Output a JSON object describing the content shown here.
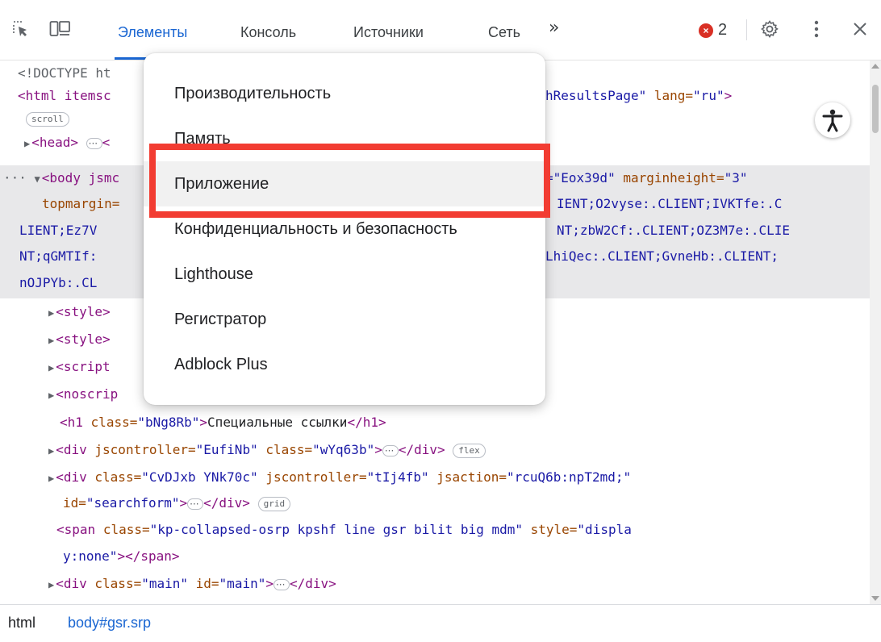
{
  "toolbar": {
    "inspect_icon": "inspect-element-icon",
    "device_icon": "device-toolbar-icon",
    "tabs": [
      "Элементы",
      "Консоль",
      "Источники",
      "Сеть"
    ],
    "more_tabs": "»",
    "error_count": "2",
    "settings_icon": "gear-icon",
    "menu_icon": "kebab-menu-icon",
    "close_icon": "close-icon"
  },
  "menu": {
    "items": [
      "Производительность",
      "Память",
      "Приложение",
      "Конфиденциальность и безопасность",
      "Lighthouse",
      "Регистратор",
      "Adblock Plus"
    ],
    "highlighted": "Приложение"
  },
  "code": {
    "doctype": "<!DOCTYPE ht",
    "html_open": "<html itemsc",
    "html_tail_attr": "hResultsPage\"",
    "html_lang_attr": "lang=",
    "html_lang_val": "\"ru\"",
    "html_close": ">",
    "scroll_badge": "scroll",
    "head_line": "<head>",
    "head_tail": "<",
    "body_ellipsis": "···",
    "body_open": "<body jsmc",
    "body_r1_val": "=\"Eox39d\"",
    "body_r1_attr": "marginheight=",
    "body_r1_val2": "\"3\"",
    "body_l2": "topmargin=",
    "body_r2": "IENT;O2vyse:.CLIENT;IVKTfe:.C",
    "body_l3": "LIENT;Ez7V",
    "body_r3": "NT;zbW2Cf:.CLIENT;OZ3M7e:.CLIE",
    "body_l4": "NT;qGMTIf:",
    "body_r4": "LhiQec:.CLIENT;GvneHb:.CLIENT;",
    "body_l5": "nOJPYb:.CL",
    "style1": "<style>",
    "style2": "<style>",
    "script": "<script",
    "noscript": "<noscrip",
    "h1_open": "<h1",
    "h1_attr": "class=",
    "h1_val": "\"bNg8Rb\"",
    "h1_text": "Специальные ссылки",
    "h1_close": "</h1>",
    "div1_open": "<div",
    "div1_attr1": "jscontroller=",
    "div1_val1": "\"EufiNb\"",
    "div1_attr2": "class=",
    "div1_val2": "\"wYq63b\"",
    "div1_close": "</div>",
    "flex_badge": "flex",
    "div2_open": "<div",
    "div2_attr1": "class=",
    "div2_val1": "\"CvDJxb YNk70c\"",
    "div2_attr2": "jscontroller=",
    "div2_val2": "\"tIj4fb\"",
    "div2_attr3": "jsaction=",
    "div2_val3": "\"rcuQ6b:npT2md;\"",
    "div2_attr4": "id=",
    "div2_val4": "\"searchform\"",
    "div2_close": "</div>",
    "grid_badge": "grid",
    "span_open": "<span",
    "span_attr1": "class=",
    "span_val1": "\"kp-collapsed-osrp kpshf line gsr bilit big mdm\"",
    "span_attr2": "style=",
    "span_val2a": "\"displa",
    "span_val2b": "y:none\"",
    "span_close": "></span>",
    "div3_open": "<div",
    "div3_attr1": "class=",
    "div3_val1": "\"main\"",
    "div3_attr2": "id=",
    "div3_val2": "\"main\"",
    "div3_close": "</div>"
  },
  "a11y_icon": "accessibility-icon",
  "breadcrumb": [
    "html",
    "body#gsr.srp"
  ],
  "colors": {
    "accent": "#1a66d2",
    "tag": "#881280",
    "attribute": "#994500",
    "value": "#1a1aa6",
    "error": "#d93025",
    "annotation_box": "#f23c32"
  }
}
